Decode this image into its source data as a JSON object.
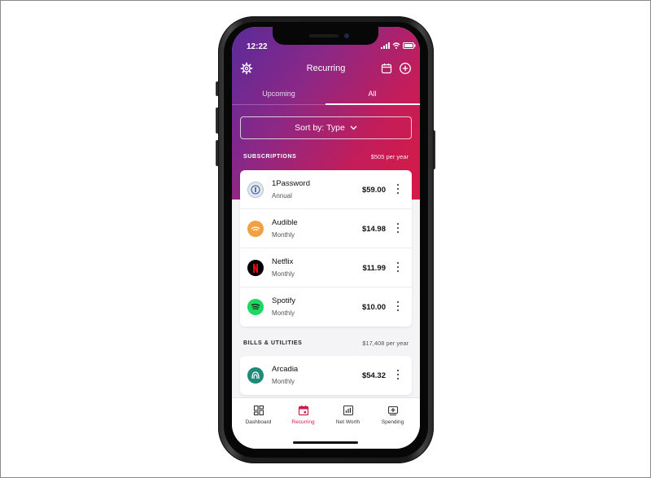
{
  "status_bar": {
    "time": "12:22"
  },
  "header": {
    "title": "Recurring"
  },
  "tabs": [
    {
      "label": "Upcoming",
      "active": false
    },
    {
      "label": "All",
      "active": true
    }
  ],
  "sort": {
    "label": "Sort by: Type"
  },
  "sections": [
    {
      "label": "SUBSCRIPTIONS",
      "total": "$505 per year",
      "items": [
        {
          "name": "1Password",
          "frequency": "Annual",
          "amount": "$59.00",
          "logo": "onepassword-logo-icon",
          "logo_color": "#dfe6ef"
        },
        {
          "name": "Audible",
          "frequency": "Monthly",
          "amount": "$14.98",
          "logo": "audible-logo-icon",
          "logo_color": "#f0a040"
        },
        {
          "name": "Netflix",
          "frequency": "Monthly",
          "amount": "$11.99",
          "logo": "netflix-logo-icon",
          "logo_color": "#000000"
        },
        {
          "name": "Spotify",
          "frequency": "Monthly",
          "amount": "$10.00",
          "logo": "spotify-logo-icon",
          "logo_color": "#1ed760"
        }
      ]
    },
    {
      "label": "BILLS & UTILITIES",
      "total": "$17,408 per year",
      "items": [
        {
          "name": "Arcadia",
          "frequency": "Monthly",
          "amount": "$54.32",
          "logo": "arcadia-logo-icon",
          "logo_color": "#1f8a78"
        }
      ]
    }
  ],
  "nav": [
    {
      "label": "Dashboard",
      "icon": "dashboard-icon",
      "active": false
    },
    {
      "label": "Recurring",
      "icon": "calendar-icon",
      "active": true
    },
    {
      "label": "Net Worth",
      "icon": "bar-chart-icon",
      "active": false
    },
    {
      "label": "Spending",
      "icon": "spending-icon",
      "active": false
    }
  ],
  "colors": {
    "accent": "#d21b47",
    "gradient_start": "#5a2a9a",
    "gradient_end": "#d71a45"
  }
}
